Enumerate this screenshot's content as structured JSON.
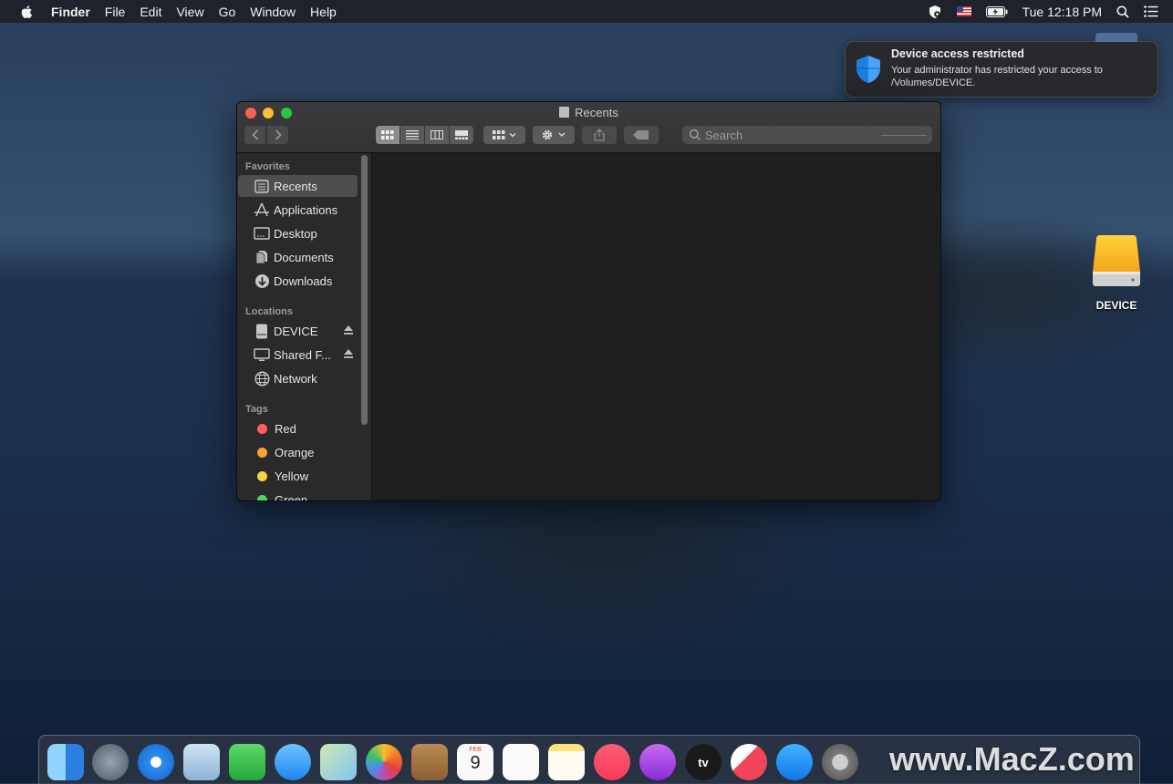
{
  "menubar": {
    "apple_icon": "apple-logo-icon",
    "items": [
      "Finder",
      "File",
      "Edit",
      "View",
      "Go",
      "Window",
      "Help"
    ],
    "clock": "Tue 12:18 PM"
  },
  "notification": {
    "title": "Device access restricted",
    "body": "Your administrator has restricted your access to /Volumes/DEVICE.",
    "icon": "shield-icon",
    "accent": "#1f7fe0"
  },
  "desktop": {
    "device_label": "DEVICE"
  },
  "finder": {
    "title": "Recents",
    "search_placeholder": "Search",
    "sidebar": {
      "favorites_heading": "Favorites",
      "favorites": [
        "Recents",
        "Applications",
        "Desktop",
        "Documents",
        "Downloads"
      ],
      "locations_heading": "Locations",
      "locations": [
        "DEVICE",
        "Shared F...",
        "Network"
      ],
      "tags_heading": "Tags",
      "tags": [
        {
          "label": "Red",
          "color": "#ff5f57"
        },
        {
          "label": "Orange",
          "color": "#f7a33a"
        },
        {
          "label": "Yellow",
          "color": "#f6d63c"
        },
        {
          "label": "Green",
          "color": "#4cd964"
        }
      ]
    }
  },
  "dock": {
    "watermark": "www.MacZ.com",
    "icons": [
      "finder-icon",
      "launchpad-icon",
      "safari-icon",
      "mail-icon",
      "facetime-icon",
      "messages-icon",
      "maps-icon",
      "photos-icon",
      "contacts-icon",
      "calendar-icon",
      "reminders-icon",
      "notes-icon",
      "music-icon",
      "podcasts-icon",
      "tv-icon",
      "news-icon",
      "app-store-icon",
      "system-preferences-icon"
    ],
    "calendar_month": "FEB",
    "calendar_day": "9",
    "tv_label": "tv"
  }
}
